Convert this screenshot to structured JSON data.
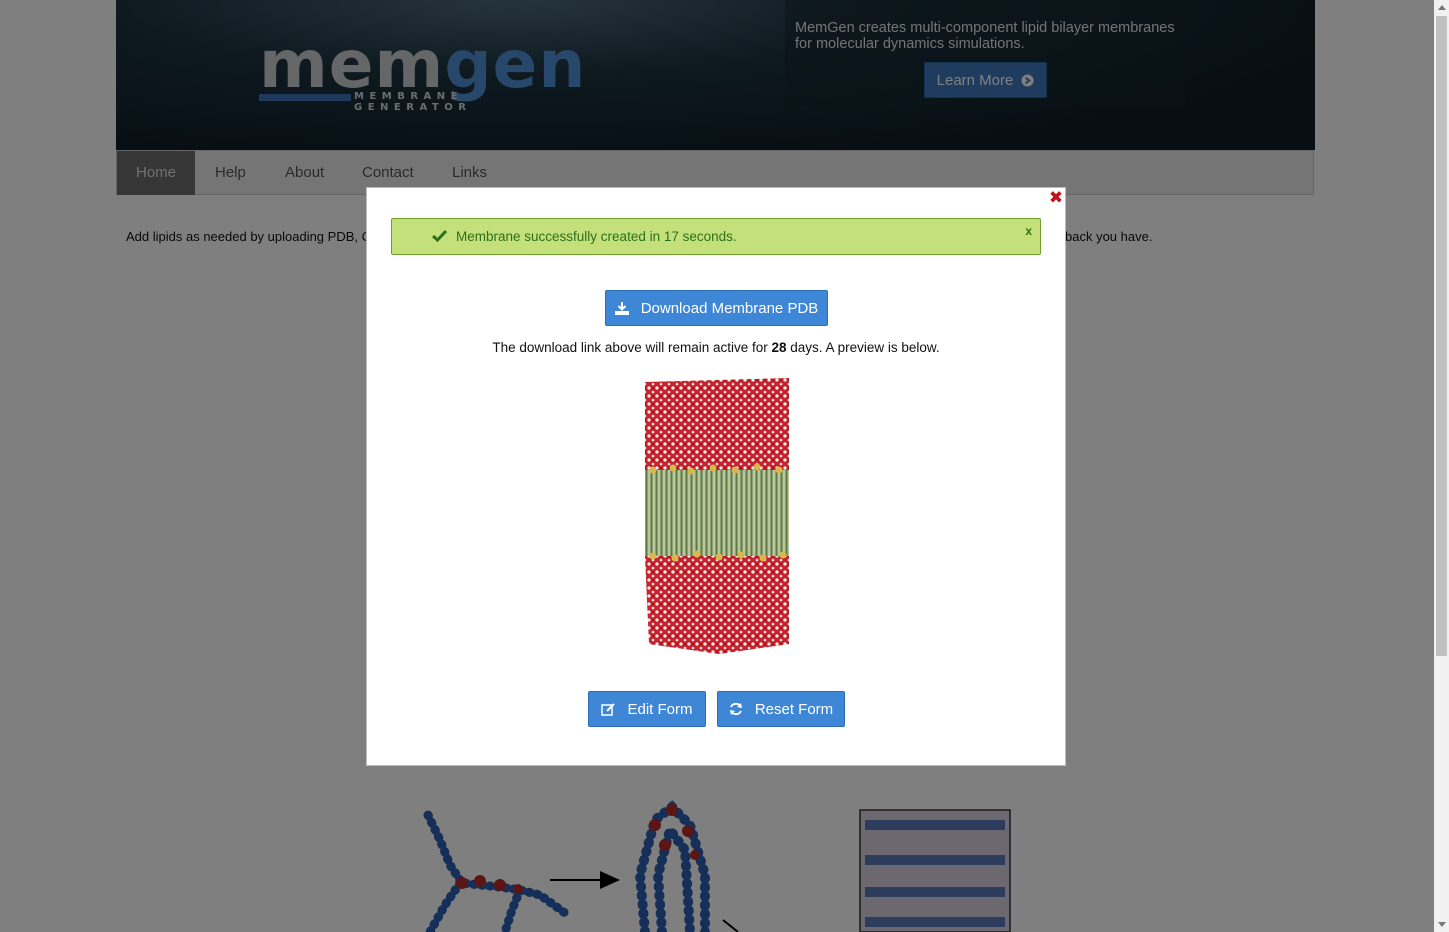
{
  "brand": {
    "logo_main_1": "mem",
    "logo_main_2": "gen",
    "logo_sub": "MEMBRANE GENERATOR"
  },
  "promo": {
    "text": "MemGen creates multi-component lipid bilayer membranes for molecular dynamics simulations.",
    "learn_more": "Learn More"
  },
  "nav": {
    "items": [
      {
        "label": "Home",
        "active": true
      },
      {
        "label": "Help",
        "active": false
      },
      {
        "label": "About",
        "active": false
      },
      {
        "label": "Contact",
        "active": false
      },
      {
        "label": "Links",
        "active": false
      }
    ]
  },
  "intro": {
    "left_text": "Add lipids as needed by uploading PDB, C",
    "right_text": "back you have."
  },
  "modal": {
    "alert": {
      "message": "Membrane successfully created in 17 seconds.",
      "dismiss": "x"
    },
    "download_label": "Download Membrane PDB",
    "notice_prefix": "The download link above will remain active for ",
    "days": "28",
    "notice_suffix": " days. A preview is below.",
    "edit_label": "Edit Form",
    "reset_label": "Reset Form"
  },
  "colors": {
    "header_dark": "#0f1f28",
    "accent_blue": "#3e86d6",
    "alert_green": "#c3e07a",
    "close_red": "#c0121a",
    "water_red": "#c8222c",
    "lipid_green": "#7f9a5a",
    "headgroup_gold": "#d9b84a"
  },
  "icons": [
    "arrow-circle-right-icon",
    "check-icon",
    "download-icon",
    "edit-icon",
    "refresh-icon",
    "close-icon"
  ]
}
